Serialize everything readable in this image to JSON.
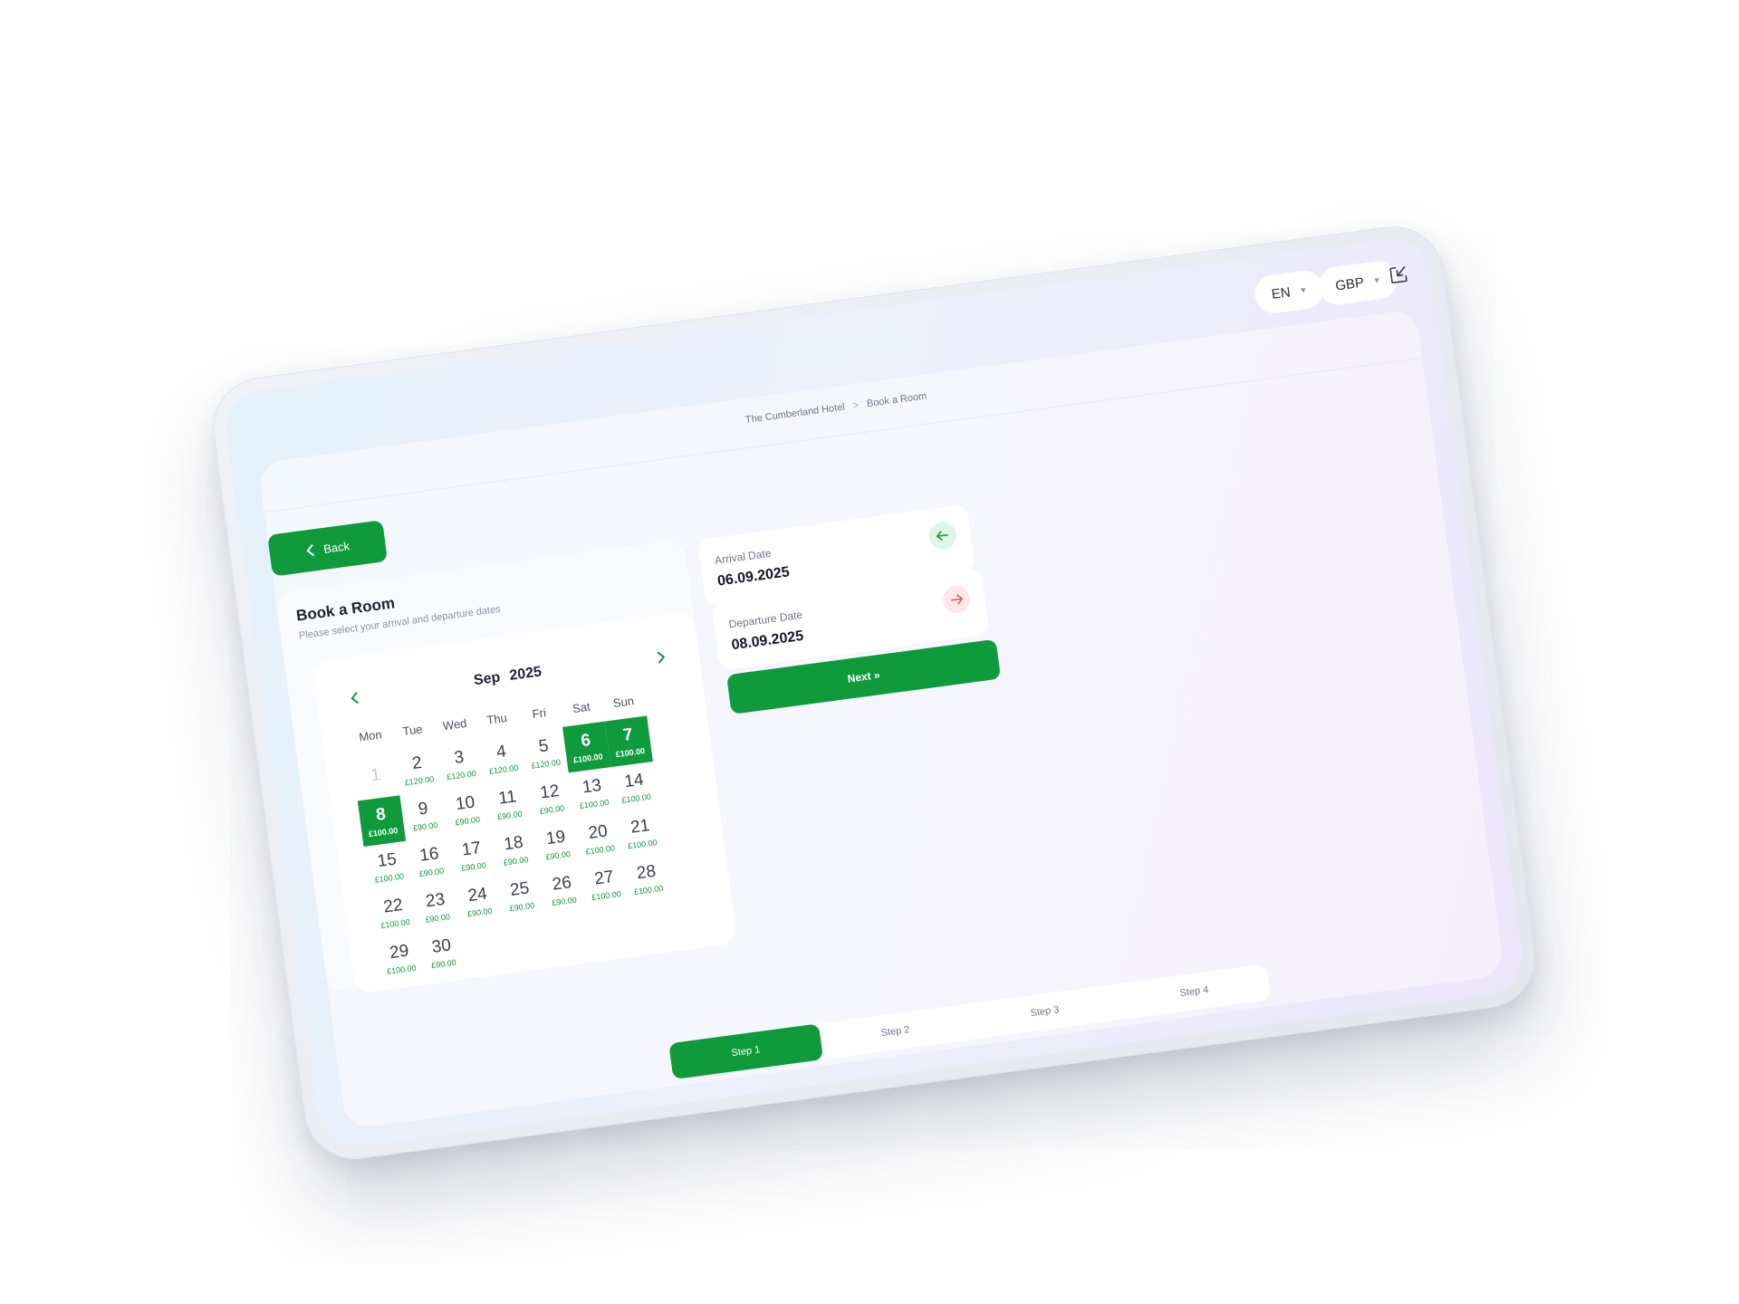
{
  "header": {
    "language": "EN",
    "currency": "GBP",
    "exit_icon": "exit-icon"
  },
  "breadcrumb": {
    "hotel": "The Cumberland Hotel",
    "separator": ">",
    "page": "Book a Room"
  },
  "back_button": {
    "label": "Back",
    "icon": "chevron-left-icon"
  },
  "booking": {
    "title": "Book a Room",
    "subtitle": "Please select your arrival and departure dates"
  },
  "calendar": {
    "month": "Sep",
    "year": "2025",
    "weekdays": [
      "Mon",
      "Tue",
      "Wed",
      "Thu",
      "Fri",
      "Sat",
      "Sun"
    ],
    "days": [
      {
        "day": "1",
        "price": "",
        "disabled": true
      },
      {
        "day": "2",
        "price": "£120.00"
      },
      {
        "day": "3",
        "price": "£120.00"
      },
      {
        "day": "4",
        "price": "£120.00"
      },
      {
        "day": "5",
        "price": "£120.00"
      },
      {
        "day": "6",
        "price": "£100.00",
        "selected": true
      },
      {
        "day": "7",
        "price": "£100.00",
        "selected": true
      },
      {
        "day": "8",
        "price": "£100.00",
        "selected": true
      },
      {
        "day": "9",
        "price": "£90.00"
      },
      {
        "day": "10",
        "price": "£90.00"
      },
      {
        "day": "11",
        "price": "£90.00"
      },
      {
        "day": "12",
        "price": "£90.00"
      },
      {
        "day": "13",
        "price": "£100.00"
      },
      {
        "day": "14",
        "price": "£100.00"
      },
      {
        "day": "15",
        "price": "£100.00"
      },
      {
        "day": "16",
        "price": "£90.00"
      },
      {
        "day": "17",
        "price": "£90.00"
      },
      {
        "day": "18",
        "price": "£90.00"
      },
      {
        "day": "19",
        "price": "£90.00"
      },
      {
        "day": "20",
        "price": "£100.00"
      },
      {
        "day": "21",
        "price": "£100.00"
      },
      {
        "day": "22",
        "price": "£100.00"
      },
      {
        "day": "23",
        "price": "£90.00"
      },
      {
        "day": "24",
        "price": "£90.00"
      },
      {
        "day": "25",
        "price": "£90.00"
      },
      {
        "day": "26",
        "price": "£90.00"
      },
      {
        "day": "27",
        "price": "£100.00"
      },
      {
        "day": "28",
        "price": "£100.00"
      },
      {
        "day": "29",
        "price": "£100.00"
      },
      {
        "day": "30",
        "price": "£90.00"
      }
    ]
  },
  "arrival": {
    "label": "Arrival Date",
    "value": "06.09.2025",
    "icon": "arrow-left-icon",
    "color": "#0f9a3c"
  },
  "departure": {
    "label": "Departure Date",
    "value": "08.09.2025",
    "icon": "arrow-right-icon",
    "color": "#e05a5a"
  },
  "next_button": {
    "label": "Next »"
  },
  "steps": [
    "Step 1",
    "Step 2",
    "Step 3",
    "Step 4"
  ],
  "active_step": 0,
  "colors": {
    "accent": "#0f9a3c"
  }
}
